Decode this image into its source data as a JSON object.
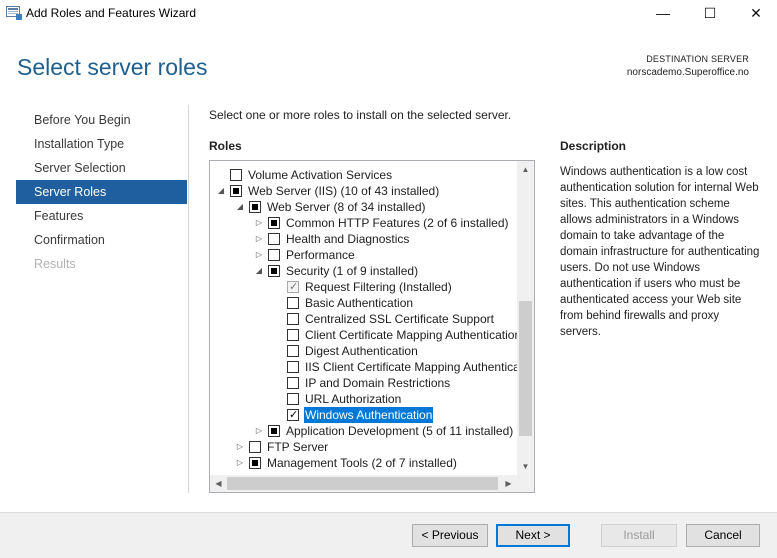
{
  "window": {
    "title": "Add Roles and Features Wizard",
    "minimize_glyph": "—",
    "maximize_glyph": "☐",
    "close_glyph": "✕"
  },
  "header": {
    "page_title": "Select server roles",
    "destination_label": "DESTINATION SERVER",
    "destination_server": "norscademo.Superoffice.no"
  },
  "nav": {
    "items": [
      {
        "label": "Before You Begin",
        "state": "normal"
      },
      {
        "label": "Installation Type",
        "state": "normal"
      },
      {
        "label": "Server Selection",
        "state": "normal"
      },
      {
        "label": "Server Roles",
        "state": "active"
      },
      {
        "label": "Features",
        "state": "normal"
      },
      {
        "label": "Confirmation",
        "state": "normal"
      },
      {
        "label": "Results",
        "state": "disabled"
      }
    ]
  },
  "main": {
    "intro": "Select one or more roles to install on the selected server.",
    "roles_heading": "Roles",
    "description_heading": "Description",
    "description_text": "Windows authentication is a low cost authentication solution for internal Web sites. This authentication scheme allows administrators in a Windows domain to take advantage of the domain infrastructure for authenticating users. Do not use Windows authentication if users who must be authenticated access your Web site from behind firewalls and proxy servers."
  },
  "roles_tree": [
    {
      "label": "Volume Activation Services",
      "level": 1,
      "expander": "",
      "check": "unchecked"
    },
    {
      "label": "Web Server (IIS) (10 of 43 installed)",
      "level": 1,
      "expander": "expanded",
      "check": "partial"
    },
    {
      "label": "Web Server (8 of 34 installed)",
      "level": 2,
      "expander": "expanded",
      "check": "partial"
    },
    {
      "label": "Common HTTP Features (2 of 6 installed)",
      "level": 3,
      "expander": "collapsed",
      "check": "partial"
    },
    {
      "label": "Health and Diagnostics",
      "level": 3,
      "expander": "collapsed",
      "check": "unchecked"
    },
    {
      "label": "Performance",
      "level": 3,
      "expander": "collapsed",
      "check": "unchecked"
    },
    {
      "label": "Security (1 of 9 installed)",
      "level": 3,
      "expander": "expanded",
      "check": "partial"
    },
    {
      "label": "Request Filtering (Installed)",
      "level": 4,
      "expander": "",
      "check": "checked-disabled"
    },
    {
      "label": "Basic Authentication",
      "level": 4,
      "expander": "",
      "check": "unchecked"
    },
    {
      "label": "Centralized SSL Certificate Support",
      "level": 4,
      "expander": "",
      "check": "unchecked"
    },
    {
      "label": "Client Certificate Mapping Authentication",
      "level": 4,
      "expander": "",
      "check": "unchecked"
    },
    {
      "label": "Digest Authentication",
      "level": 4,
      "expander": "",
      "check": "unchecked"
    },
    {
      "label": "IIS Client Certificate Mapping Authentication",
      "level": 4,
      "expander": "",
      "check": "unchecked"
    },
    {
      "label": "IP and Domain Restrictions",
      "level": 4,
      "expander": "",
      "check": "unchecked"
    },
    {
      "label": "URL Authorization",
      "level": 4,
      "expander": "",
      "check": "unchecked"
    },
    {
      "label": "Windows Authentication",
      "level": 4,
      "expander": "",
      "check": "checked",
      "selected": true
    },
    {
      "label": "Application Development (5 of 11 installed)",
      "level": 3,
      "expander": "collapsed",
      "check": "partial"
    },
    {
      "label": "FTP Server",
      "level": 2,
      "expander": "collapsed",
      "check": "unchecked"
    },
    {
      "label": "Management Tools (2 of 7 installed)",
      "level": 2,
      "expander": "collapsed",
      "check": "partial"
    }
  ],
  "glyphs": {
    "expanded": "◢",
    "collapsed": "▷",
    "scroll_up": "▲",
    "scroll_down": "▼",
    "scroll_left": "◀",
    "scroll_right": "▶"
  },
  "buttons": {
    "previous": "< Previous",
    "next": "Next >",
    "install": "Install",
    "cancel": "Cancel"
  },
  "colors": {
    "accent": "#1f5f9f",
    "title_blue": "#1f5f8e",
    "selection": "#0078d7"
  }
}
